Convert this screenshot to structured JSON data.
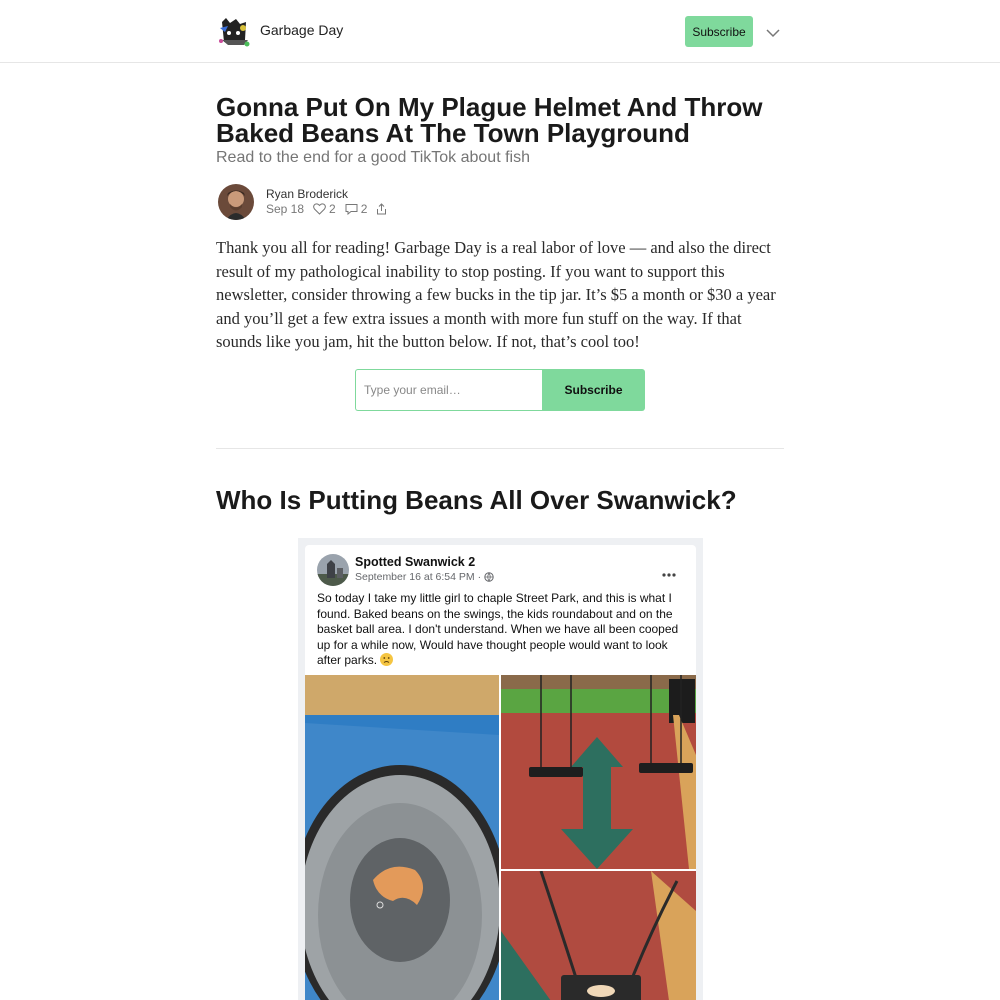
{
  "header": {
    "publication_name": "Garbage Day",
    "subscribe_label": "Subscribe",
    "logo_icon": "garbage-day-logo",
    "menu_icon": "chevron-down-icon"
  },
  "post": {
    "title": "Gonna Put On My Plague Helmet And Throw Baked Beans At The Town Playground",
    "subtitle": "Read to the end for a good TikTok about fish",
    "author": "Ryan Broderick",
    "date": "Sep 18",
    "likes": "2",
    "comments": "2",
    "like_icon": "heart-icon",
    "comment_icon": "comment-icon",
    "share_icon": "share-icon",
    "intro": "Thank you all for reading! Garbage Day is a real labor of love — and also the direct result of my pathological inability to stop posting. If you want to support this newsletter, consider throwing a few bucks in the tip jar. It’s $5 a month or $30 a year and you’ll get a few extra issues a month with more fun stuff on the way. If that sounds like you jam, hit the button below. If not, that’s cool too!",
    "email_placeholder": "Type your email…",
    "email_value": "",
    "subscribe_label": "Subscribe",
    "section_heading": "Who Is Putting Beans All Over Swanwick?"
  },
  "embedded_post": {
    "page_name": "Spotted Swanwick 2",
    "timestamp": "September 16 at 6:54 PM ·",
    "audience_icon": "globe-icon",
    "more_icon": "more-options-icon",
    "text": "So today I take my little girl to chaple Street Park, and this is what I found. Baked beans on the swings, the kids roundabout and on the basket ball area. I don't understand. When we have all been cooped up for a while now, Would have thought people would want to look after parks.",
    "emoji": "disappointed-face-emoji",
    "photos": [
      "roundabout-with-beans",
      "swings-over-red-surface",
      "swing-seat-with-beans"
    ]
  },
  "colors": {
    "accent": "#7fd99c",
    "text": "#1a1a1a",
    "muted": "#757575",
    "divider": "#e6e6e6"
  }
}
